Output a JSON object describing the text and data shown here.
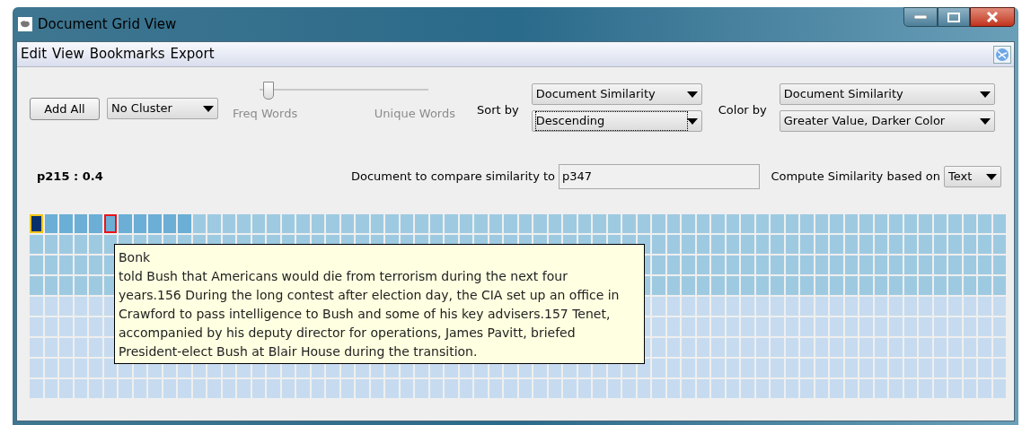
{
  "window": {
    "title": "Document Grid View"
  },
  "menu": [
    "Edit",
    "View",
    "Bookmarks",
    "Export"
  ],
  "toolbar": {
    "add_button": "Add All",
    "cluster": "No Cluster",
    "slider": {
      "level": 0.03,
      "min_label": "Freq Words",
      "max_label": "Unique Words"
    },
    "sort": {
      "label": "Sort by",
      "field": "Document Similarity",
      "order": "Descending",
      "order_focused": true
    },
    "color": {
      "label": "Color by",
      "field": "Document Similarity",
      "scheme": "Greater Value, Darker Color"
    }
  },
  "info": {
    "selected_doc": "p215 : 0.4",
    "compare_label": "Document to compare similarity to",
    "compare_value": "p347",
    "compute_label": "Compute Similarity based on",
    "compute_value": "Text"
  },
  "grid": {
    "rows": [
      {
        "cells": [
          {
            "color": "#08306b",
            "selected": true,
            "hovered": false
          },
          {
            "color": "#6baed6",
            "selected": false,
            "hovered": false
          },
          {
            "color": "#6baed6",
            "selected": false,
            "hovered": false
          },
          {
            "color": "#6baed6",
            "selected": false,
            "hovered": false
          },
          {
            "color": "#6baed6",
            "selected": false,
            "hovered": false
          },
          {
            "color": "#6baed6",
            "selected": false,
            "hovered": true
          },
          {
            "color": "#6baed6",
            "selected": false,
            "hovered": false
          },
          {
            "color": "#6baed6",
            "selected": false,
            "hovered": false
          },
          {
            "color": "#6baed6",
            "selected": false,
            "hovered": false
          },
          {
            "color": "#6baed6",
            "selected": false,
            "hovered": false
          },
          {
            "color": "#6baed6",
            "selected": false,
            "hovered": false
          },
          {
            "color": "#9ecae1",
            "selected": false,
            "hovered": false
          },
          {
            "color": "#9ecae1",
            "selected": false,
            "hovered": false
          },
          {
            "color": "#9ecae1",
            "selected": false,
            "hovered": false
          },
          {
            "color": "#9ecae1",
            "selected": false,
            "hovered": false
          },
          {
            "color": "#9ecae1",
            "selected": false,
            "hovered": false
          },
          {
            "color": "#9ecae1",
            "selected": false,
            "hovered": false
          },
          {
            "color": "#9ecae1",
            "selected": false,
            "hovered": false
          },
          {
            "color": "#9ecae1",
            "selected": false,
            "hovered": false
          },
          {
            "color": "#9ecae1",
            "selected": false,
            "hovered": false
          },
          {
            "color": "#9ecae1",
            "selected": false,
            "hovered": false
          },
          {
            "color": "#9ecae1",
            "selected": false,
            "hovered": false
          },
          {
            "color": "#9ecae1",
            "selected": false,
            "hovered": false
          },
          {
            "color": "#9ecae1",
            "selected": false,
            "hovered": false
          },
          {
            "color": "#9ecae1",
            "selected": false,
            "hovered": false
          },
          {
            "color": "#9ecae1",
            "selected": false,
            "hovered": false
          },
          {
            "color": "#9ecae1",
            "selected": false,
            "hovered": false
          },
          {
            "color": "#9ecae1",
            "selected": false,
            "hovered": false
          },
          {
            "color": "#9ecae1",
            "selected": false,
            "hovered": false
          },
          {
            "color": "#9ecae1",
            "selected": false,
            "hovered": false
          },
          {
            "color": "#9ecae1",
            "selected": false,
            "hovered": false
          },
          {
            "color": "#9ecae1",
            "selected": false,
            "hovered": false
          },
          {
            "color": "#9ecae1",
            "selected": false,
            "hovered": false
          },
          {
            "color": "#9ecae1",
            "selected": false,
            "hovered": false
          },
          {
            "color": "#9ecae1",
            "selected": false,
            "hovered": false
          },
          {
            "color": "#9ecae1",
            "selected": false,
            "hovered": false
          },
          {
            "color": "#9ecae1",
            "selected": false,
            "hovered": false
          },
          {
            "color": "#9ecae1",
            "selected": false,
            "hovered": false
          },
          {
            "color": "#9ecae1",
            "selected": false,
            "hovered": false
          },
          {
            "color": "#9ecae1",
            "selected": false,
            "hovered": false
          },
          {
            "color": "#9ecae1",
            "selected": false,
            "hovered": false
          },
          {
            "color": "#9ecae1",
            "selected": false,
            "hovered": false
          },
          {
            "color": "#9ecae1",
            "selected": false,
            "hovered": false
          },
          {
            "color": "#9ecae1",
            "selected": false,
            "hovered": false
          },
          {
            "color": "#9ecae1",
            "selected": false,
            "hovered": false
          },
          {
            "color": "#9ecae1",
            "selected": false,
            "hovered": false
          },
          {
            "color": "#9ecae1",
            "selected": false,
            "hovered": false
          },
          {
            "color": "#9ecae1",
            "selected": false,
            "hovered": false
          },
          {
            "color": "#9ecae1",
            "selected": false,
            "hovered": false
          },
          {
            "color": "#9ecae1",
            "selected": false,
            "hovered": false
          },
          {
            "color": "#9ecae1",
            "selected": false,
            "hovered": false
          },
          {
            "color": "#9ecae1",
            "selected": false,
            "hovered": false
          },
          {
            "color": "#9ecae1",
            "selected": false,
            "hovered": false
          },
          {
            "color": "#9ecae1",
            "selected": false,
            "hovered": false
          },
          {
            "color": "#9ecae1",
            "selected": false,
            "hovered": false
          },
          {
            "color": "#9ecae1",
            "selected": false,
            "hovered": false
          },
          {
            "color": "#9ecae1",
            "selected": false,
            "hovered": false
          },
          {
            "color": "#9ecae1",
            "selected": false,
            "hovered": false
          },
          {
            "color": "#9ecae1",
            "selected": false,
            "hovered": false
          },
          {
            "color": "#9ecae1",
            "selected": false,
            "hovered": false
          },
          {
            "color": "#9ecae1",
            "selected": false,
            "hovered": false
          },
          {
            "color": "#9ecae1",
            "selected": false,
            "hovered": false
          },
          {
            "color": "#9ecae1",
            "selected": false,
            "hovered": false
          },
          {
            "color": "#9ecae1",
            "selected": false,
            "hovered": false
          },
          {
            "color": "#9ecae1",
            "selected": false,
            "hovered": false
          },
          {
            "color": "#9ecae1",
            "selected": false,
            "hovered": false
          }
        ]
      },
      {
        "cells": [
          {
            "color": "#9ecae1"
          },
          {
            "color": "#9ecae1"
          },
          {
            "color": "#9ecae1"
          },
          {
            "color": "#9ecae1"
          },
          {
            "color": "#9ecae1"
          },
          {
            "color": "#9ecae1"
          },
          {
            "color": "#9ecae1"
          },
          {
            "color": "#9ecae1"
          },
          {
            "color": "#9ecae1"
          },
          {
            "color": "#9ecae1"
          },
          {
            "color": "#9ecae1"
          },
          {
            "color": "#9ecae1"
          },
          {
            "color": "#9ecae1"
          },
          {
            "color": "#9ecae1"
          },
          {
            "color": "#9ecae1"
          },
          {
            "color": "#9ecae1"
          },
          {
            "color": "#9ecae1"
          },
          {
            "color": "#9ecae1"
          },
          {
            "color": "#9ecae1"
          },
          {
            "color": "#9ecae1"
          },
          {
            "color": "#9ecae1"
          },
          {
            "color": "#9ecae1"
          },
          {
            "color": "#9ecae1"
          },
          {
            "color": "#9ecae1"
          },
          {
            "color": "#9ecae1"
          },
          {
            "color": "#9ecae1"
          },
          {
            "color": "#9ecae1"
          },
          {
            "color": "#9ecae1"
          },
          {
            "color": "#9ecae1"
          },
          {
            "color": "#9ecae1"
          },
          {
            "color": "#9ecae1"
          },
          {
            "color": "#9ecae1"
          },
          {
            "color": "#9ecae1"
          },
          {
            "color": "#9ecae1"
          },
          {
            "color": "#9ecae1"
          },
          {
            "color": "#9ecae1"
          },
          {
            "color": "#9ecae1"
          },
          {
            "color": "#9ecae1"
          },
          {
            "color": "#9ecae1"
          },
          {
            "color": "#9ecae1"
          },
          {
            "color": "#9ecae1"
          },
          {
            "color": "#9ecae1"
          },
          {
            "color": "#9ecae1"
          },
          {
            "color": "#9ecae1"
          },
          {
            "color": "#9ecae1"
          },
          {
            "color": "#9ecae1"
          },
          {
            "color": "#9ecae1"
          },
          {
            "color": "#9ecae1"
          },
          {
            "color": "#9ecae1"
          },
          {
            "color": "#9ecae1"
          },
          {
            "color": "#9ecae1"
          },
          {
            "color": "#9ecae1"
          },
          {
            "color": "#9ecae1"
          },
          {
            "color": "#9ecae1"
          },
          {
            "color": "#9ecae1"
          },
          {
            "color": "#9ecae1"
          },
          {
            "color": "#9ecae1"
          },
          {
            "color": "#9ecae1"
          },
          {
            "color": "#9ecae1"
          },
          {
            "color": "#9ecae1"
          },
          {
            "color": "#9ecae1"
          },
          {
            "color": "#9ecae1"
          },
          {
            "color": "#9ecae1"
          },
          {
            "color": "#9ecae1"
          },
          {
            "color": "#9ecae1"
          },
          {
            "color": "#9ecae1"
          }
        ]
      },
      {
        "cells": [
          {
            "color": "#9ecae1"
          },
          {
            "color": "#9ecae1"
          },
          {
            "color": "#9ecae1"
          },
          {
            "color": "#9ecae1"
          },
          {
            "color": "#9ecae1"
          },
          {
            "color": "#9ecae1"
          },
          null,
          null,
          null,
          null,
          null,
          null,
          null,
          null,
          null,
          null,
          null,
          null,
          null,
          null,
          null,
          null,
          null,
          null,
          null,
          null,
          null,
          null,
          null,
          null,
          null,
          null,
          null,
          null,
          null,
          null,
          null,
          null,
          null,
          null,
          null,
          {
            "color": "#9ecae1"
          },
          {
            "color": "#9ecae1"
          },
          {
            "color": "#9ecae1"
          },
          {
            "color": "#9ecae1"
          },
          {
            "color": "#9ecae1"
          },
          {
            "color": "#9ecae1"
          },
          {
            "color": "#9ecae1"
          },
          {
            "color": "#9ecae1"
          },
          {
            "color": "#9ecae1"
          },
          {
            "color": "#9ecae1"
          },
          {
            "color": "#9ecae1"
          },
          {
            "color": "#9ecae1"
          },
          {
            "color": "#9ecae1"
          },
          {
            "color": "#9ecae1"
          },
          {
            "color": "#9ecae1"
          },
          {
            "color": "#9ecae1"
          },
          {
            "color": "#9ecae1"
          },
          {
            "color": "#9ecae1"
          },
          {
            "color": "#9ecae1"
          },
          {
            "color": "#9ecae1"
          },
          {
            "color": "#9ecae1"
          },
          {
            "color": "#9ecae1"
          },
          {
            "color": "#9ecae1"
          },
          {
            "color": "#9ecae1"
          },
          {
            "color": "#9ecae1"
          }
        ]
      },
      {
        "cells": [
          {
            "color": "#9ecae1"
          },
          {
            "color": "#9ecae1"
          },
          {
            "color": "#9ecae1"
          },
          {
            "color": "#9ecae1"
          },
          {
            "color": "#9ecae1"
          },
          {
            "color": "#9ecae1"
          },
          null,
          null,
          null,
          null,
          null,
          null,
          null,
          null,
          null,
          null,
          null,
          null,
          null,
          null,
          null,
          null,
          null,
          null,
          null,
          null,
          null,
          null,
          null,
          null,
          null,
          null,
          null,
          null,
          null,
          null,
          null,
          null,
          null,
          null,
          null,
          {
            "color": "#9ecae1"
          },
          {
            "color": "#9ecae1"
          },
          {
            "color": "#9ecae1"
          },
          {
            "color": "#9ecae1"
          },
          {
            "color": "#9ecae1"
          },
          {
            "color": "#9ecae1"
          },
          {
            "color": "#9ecae1"
          },
          {
            "color": "#9ecae1"
          },
          {
            "color": "#9ecae1"
          },
          {
            "color": "#9ecae1"
          },
          {
            "color": "#9ecae1"
          },
          {
            "color": "#9ecae1"
          },
          {
            "color": "#9ecae1"
          },
          {
            "color": "#9ecae1"
          },
          {
            "color": "#9ecae1"
          },
          {
            "color": "#9ecae1"
          },
          {
            "color": "#9ecae1"
          },
          {
            "color": "#9ecae1"
          },
          {
            "color": "#9ecae1"
          },
          {
            "color": "#9ecae1"
          },
          {
            "color": "#9ecae1"
          },
          {
            "color": "#9ecae1"
          },
          {
            "color": "#9ecae1"
          },
          {
            "color": "#9ecae1"
          },
          {
            "color": "#9ecae1"
          }
        ]
      },
      {
        "cells": [
          {
            "color": "#c6dbef"
          },
          {
            "color": "#c6dbef"
          },
          {
            "color": "#c6dbef"
          },
          {
            "color": "#c6dbef"
          },
          {
            "color": "#c6dbef"
          },
          {
            "color": "#c6dbef"
          },
          null,
          null,
          null,
          null,
          null,
          null,
          null,
          null,
          null,
          null,
          null,
          null,
          null,
          null,
          null,
          null,
          null,
          null,
          null,
          null,
          null,
          null,
          null,
          null,
          null,
          null,
          null,
          null,
          null,
          null,
          null,
          null,
          null,
          null,
          null,
          {
            "color": "#c6dbef"
          },
          {
            "color": "#c6dbef"
          },
          {
            "color": "#c6dbef"
          },
          {
            "color": "#c6dbef"
          },
          {
            "color": "#c6dbef"
          },
          {
            "color": "#c6dbef"
          },
          {
            "color": "#c6dbef"
          },
          {
            "color": "#c6dbef"
          },
          {
            "color": "#c6dbef"
          },
          {
            "color": "#c6dbef"
          },
          {
            "color": "#c6dbef"
          },
          {
            "color": "#c6dbef"
          },
          {
            "color": "#c6dbef"
          },
          {
            "color": "#c6dbef"
          },
          {
            "color": "#c6dbef"
          },
          {
            "color": "#c6dbef"
          },
          {
            "color": "#c6dbef"
          },
          {
            "color": "#c6dbef"
          },
          {
            "color": "#c6dbef"
          },
          {
            "color": "#c6dbef"
          },
          {
            "color": "#c6dbef"
          },
          {
            "color": "#c6dbef"
          },
          {
            "color": "#c6dbef"
          },
          {
            "color": "#c6dbef"
          },
          {
            "color": "#c6dbef"
          }
        ]
      },
      {
        "cells": [
          {
            "color": "#c6dbef"
          },
          {
            "color": "#c6dbef"
          },
          {
            "color": "#c6dbef"
          },
          {
            "color": "#c6dbef"
          },
          {
            "color": "#c6dbef"
          },
          {
            "color": "#c6dbef"
          },
          null,
          null,
          null,
          null,
          null,
          null,
          null,
          null,
          null,
          null,
          null,
          null,
          null,
          null,
          null,
          null,
          null,
          null,
          null,
          null,
          null,
          null,
          null,
          null,
          null,
          null,
          null,
          null,
          null,
          null,
          null,
          null,
          null,
          null,
          null,
          {
            "color": "#c6dbef"
          },
          {
            "color": "#c6dbef"
          },
          {
            "color": "#c6dbef"
          },
          {
            "color": "#c6dbef"
          },
          {
            "color": "#c6dbef"
          },
          {
            "color": "#c6dbef"
          },
          {
            "color": "#c6dbef"
          },
          {
            "color": "#c6dbef"
          },
          {
            "color": "#c6dbef"
          },
          {
            "color": "#c6dbef"
          },
          {
            "color": "#c6dbef"
          },
          {
            "color": "#c6dbef"
          },
          {
            "color": "#c6dbef"
          },
          {
            "color": "#c6dbef"
          },
          {
            "color": "#c6dbef"
          },
          {
            "color": "#c6dbef"
          },
          {
            "color": "#c6dbef"
          },
          {
            "color": "#c6dbef"
          },
          {
            "color": "#c6dbef"
          },
          {
            "color": "#c6dbef"
          },
          {
            "color": "#c6dbef"
          },
          {
            "color": "#c6dbef"
          },
          {
            "color": "#c6dbef"
          },
          {
            "color": "#c6dbef"
          },
          {
            "color": "#c6dbef"
          }
        ]
      },
      {
        "cells": [
          {
            "color": "#c6dbef"
          },
          {
            "color": "#c6dbef"
          },
          {
            "color": "#c6dbef"
          },
          {
            "color": "#c6dbef"
          },
          {
            "color": "#c6dbef"
          },
          {
            "color": "#c6dbef"
          },
          null,
          null,
          null,
          null,
          null,
          null,
          null,
          null,
          null,
          null,
          null,
          null,
          null,
          null,
          null,
          null,
          null,
          null,
          null,
          null,
          null,
          null,
          null,
          null,
          null,
          null,
          null,
          null,
          null,
          null,
          null,
          null,
          null,
          null,
          null,
          {
            "color": "#c6dbef"
          },
          {
            "color": "#c6dbef"
          },
          {
            "color": "#c6dbef"
          },
          {
            "color": "#c6dbef"
          },
          {
            "color": "#c6dbef"
          },
          {
            "color": "#c6dbef"
          },
          {
            "color": "#c6dbef"
          },
          {
            "color": "#c6dbef"
          },
          {
            "color": "#c6dbef"
          },
          {
            "color": "#c6dbef"
          },
          {
            "color": "#c6dbef"
          },
          {
            "color": "#c6dbef"
          },
          {
            "color": "#c6dbef"
          },
          {
            "color": "#c6dbef"
          },
          {
            "color": "#c6dbef"
          },
          {
            "color": "#c6dbef"
          },
          {
            "color": "#c6dbef"
          },
          {
            "color": "#c6dbef"
          },
          {
            "color": "#c6dbef"
          },
          {
            "color": "#c6dbef"
          },
          {
            "color": "#c6dbef"
          },
          {
            "color": "#c6dbef"
          },
          {
            "color": "#c6dbef"
          },
          {
            "color": "#c6dbef"
          },
          {
            "color": "#c6dbef"
          }
        ]
      },
      {
        "cells": [
          {
            "color": "#c6dbef"
          },
          {
            "color": "#c6dbef"
          },
          {
            "color": "#c6dbef"
          },
          {
            "color": "#c6dbef"
          },
          {
            "color": "#c6dbef"
          },
          {
            "color": "#c6dbef"
          },
          {
            "color": "#c6dbef"
          },
          {
            "color": "#c6dbef"
          },
          {
            "color": "#c6dbef"
          },
          {
            "color": "#c6dbef"
          },
          {
            "color": "#c6dbef"
          },
          {
            "color": "#c6dbef"
          },
          {
            "color": "#c6dbef"
          },
          {
            "color": "#c6dbef"
          },
          {
            "color": "#c6dbef"
          },
          {
            "color": "#c6dbef"
          },
          {
            "color": "#c6dbef"
          },
          {
            "color": "#c6dbef"
          },
          {
            "color": "#c6dbef"
          },
          {
            "color": "#c6dbef"
          },
          {
            "color": "#c6dbef"
          },
          {
            "color": "#c6dbef"
          },
          {
            "color": "#c6dbef"
          },
          {
            "color": "#c6dbef"
          },
          {
            "color": "#c6dbef"
          },
          {
            "color": "#c6dbef"
          },
          {
            "color": "#c6dbef"
          },
          {
            "color": "#c6dbef"
          },
          {
            "color": "#c6dbef"
          },
          {
            "color": "#c6dbef"
          },
          {
            "color": "#c6dbef"
          },
          {
            "color": "#c6dbef"
          },
          {
            "color": "#c6dbef"
          },
          {
            "color": "#c6dbef"
          },
          {
            "color": "#c6dbef"
          },
          {
            "color": "#c6dbef"
          },
          {
            "color": "#c6dbef"
          },
          {
            "color": "#c6dbef"
          },
          {
            "color": "#c6dbef"
          },
          {
            "color": "#c6dbef"
          },
          {
            "color": "#c6dbef"
          },
          {
            "color": "#c6dbef"
          },
          {
            "color": "#c6dbef"
          },
          {
            "color": "#c6dbef"
          },
          {
            "color": "#c6dbef"
          },
          {
            "color": "#c6dbef"
          },
          {
            "color": "#c6dbef"
          },
          {
            "color": "#c6dbef"
          },
          {
            "color": "#c6dbef"
          },
          {
            "color": "#c6dbef"
          },
          {
            "color": "#c6dbef"
          },
          {
            "color": "#c6dbef"
          },
          {
            "color": "#c6dbef"
          },
          {
            "color": "#c6dbef"
          },
          {
            "color": "#c6dbef"
          },
          {
            "color": "#c6dbef"
          },
          {
            "color": "#c6dbef"
          },
          {
            "color": "#c6dbef"
          },
          {
            "color": "#c6dbef"
          },
          {
            "color": "#c6dbef"
          },
          {
            "color": "#c6dbef"
          },
          {
            "color": "#c6dbef"
          },
          {
            "color": "#c6dbef"
          },
          {
            "color": "#c6dbef"
          },
          {
            "color": "#c6dbef"
          },
          {
            "color": "#c6dbef"
          }
        ]
      },
      {
        "cells": [
          {
            "color": "#c6dbef"
          },
          {
            "color": "#c6dbef"
          },
          {
            "color": "#c6dbef"
          },
          {
            "color": "#c6dbef"
          },
          {
            "color": "#c6dbef"
          },
          {
            "color": "#c6dbef"
          },
          {
            "color": "#c6dbef"
          },
          {
            "color": "#c6dbef"
          },
          {
            "color": "#c6dbef"
          },
          {
            "color": "#c6dbef"
          },
          {
            "color": "#c6dbef"
          },
          {
            "color": "#c6dbef"
          },
          {
            "color": "#c6dbef"
          },
          {
            "color": "#c6dbef"
          },
          {
            "color": "#c6dbef"
          },
          {
            "color": "#c6dbef"
          },
          {
            "color": "#c6dbef"
          },
          {
            "color": "#c6dbef"
          },
          {
            "color": "#c6dbef"
          },
          {
            "color": "#c6dbef"
          },
          {
            "color": "#c6dbef"
          },
          {
            "color": "#c6dbef"
          },
          {
            "color": "#c6dbef"
          },
          {
            "color": "#c6dbef"
          },
          {
            "color": "#c6dbef"
          },
          {
            "color": "#c6dbef"
          },
          {
            "color": "#c6dbef"
          },
          {
            "color": "#c6dbef"
          },
          {
            "color": "#c6dbef"
          },
          {
            "color": "#c6dbef"
          },
          {
            "color": "#c6dbef"
          },
          {
            "color": "#c6dbef"
          },
          {
            "color": "#c6dbef"
          },
          {
            "color": "#c6dbef"
          },
          {
            "color": "#c6dbef"
          },
          {
            "color": "#c6dbef"
          },
          {
            "color": "#c6dbef"
          },
          {
            "color": "#c6dbef"
          },
          {
            "color": "#c6dbef"
          },
          {
            "color": "#c6dbef"
          },
          {
            "color": "#c6dbef"
          },
          {
            "color": "#c6dbef"
          },
          {
            "color": "#c6dbef"
          },
          {
            "color": "#c6dbef"
          },
          {
            "color": "#c6dbef"
          },
          {
            "color": "#c6dbef"
          },
          {
            "color": "#c6dbef"
          },
          {
            "color": "#c6dbef"
          },
          {
            "color": "#c6dbef"
          },
          {
            "color": "#c6dbef"
          },
          {
            "color": "#c6dbef"
          },
          {
            "color": "#c6dbef"
          },
          {
            "color": "#c6dbef"
          },
          {
            "color": "#c6dbef"
          },
          {
            "color": "#c6dbef"
          },
          {
            "color": "#c6dbef"
          },
          {
            "color": "#c6dbef"
          },
          {
            "color": "#c6dbef"
          },
          {
            "color": "#c6dbef"
          },
          {
            "color": "#c6dbef"
          },
          {
            "color": "#c6dbef"
          },
          {
            "color": "#c6dbef"
          },
          {
            "color": "#c6dbef"
          },
          {
            "color": "#c6dbef"
          },
          {
            "color": "#c6dbef"
          },
          {
            "color": "#c6dbef"
          }
        ]
      }
    ]
  },
  "tooltip": {
    "title": "Bonk",
    "lines": [
      "told Bush that Americans would die from terrorism during the next four",
      "years.156 During the long contest after election day, the CIA set up an office in",
      "Crawford to pass intelligence to Bush and some of his key advisers.157 Tenet,",
      "accompanied by his deputy director for operations, James Pavitt, briefed",
      "President-elect Bush at Blair House during the transition."
    ]
  }
}
